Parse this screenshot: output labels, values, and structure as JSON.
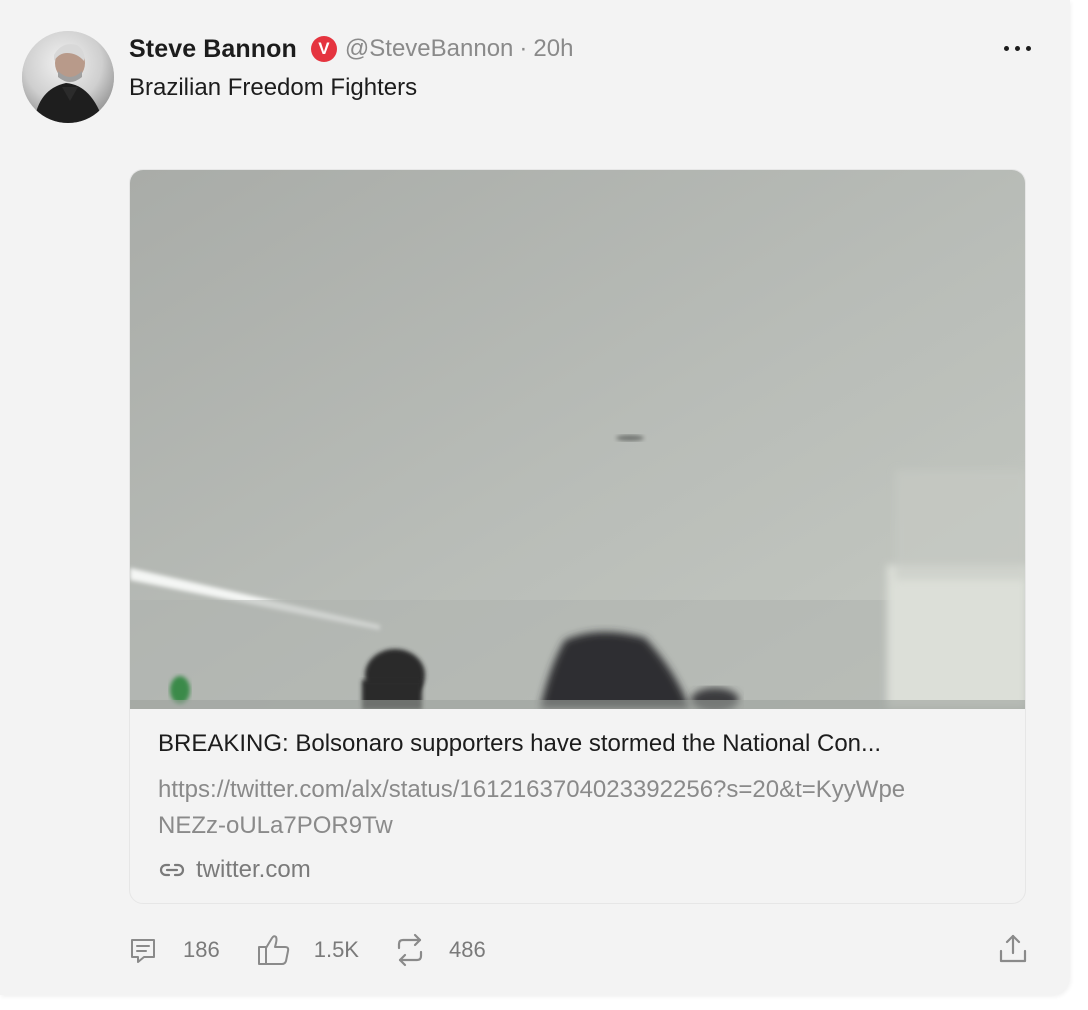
{
  "post": {
    "author": {
      "name": "Steve Bannon",
      "badge": "V",
      "handle": "@SteveBannon",
      "separator": "·",
      "time": "20h"
    },
    "text": "Brazilian Freedom Fighters",
    "link_card": {
      "title": "BREAKING: Bolsonaro supporters have stormed the National Con...",
      "url": "https://twitter.com/alx/status/1612163704023392256?s=20&t=KyyWpeNEZz-oULa7POR9Tw",
      "domain": "twitter.com"
    },
    "actions": {
      "replies": "186",
      "likes": "1.5K",
      "reposts": "486"
    }
  },
  "icons": {
    "more": "more-options-icon",
    "link": "link-icon",
    "reply": "reply-icon",
    "like": "thumbs-up-icon",
    "repost": "repost-icon",
    "share": "share-icon"
  },
  "colors": {
    "background": "#f3f3f3",
    "badge": "#e5343f",
    "primary_text": "#1c1c1c",
    "secondary_text": "#8a8a8a"
  }
}
